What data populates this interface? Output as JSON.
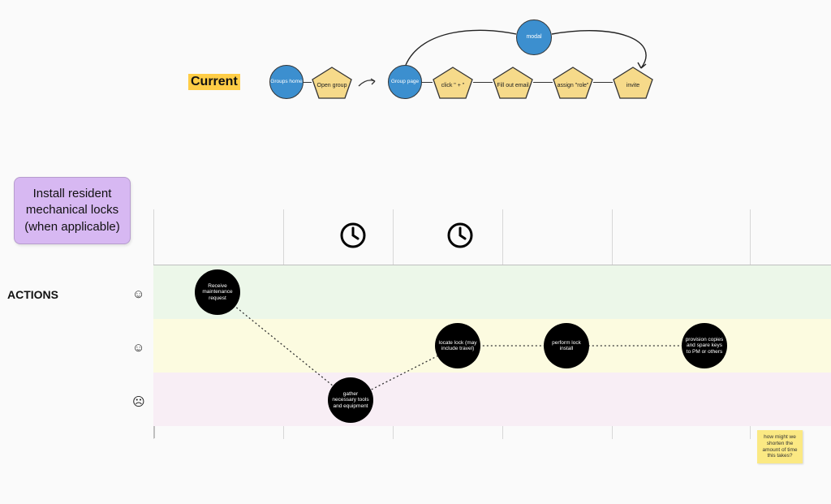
{
  "top_flow": {
    "label": "Current",
    "nodes": {
      "groups_home": "Groups home",
      "open_group": "Open group",
      "group_page": "Group page",
      "click_plus": "click \" + \"",
      "fill_email": "Fill out email",
      "assign_role": "assign \"role\"",
      "invite": "invite",
      "modal": "modal"
    }
  },
  "journey": {
    "card": "Install resident mechanical locks\n(when applicable)",
    "row_label": "ACTIONS",
    "faces": {
      "happy": "☺",
      "neutral": "☺",
      "sad": "☹"
    },
    "actions": [
      "Receive maintenance request",
      "gather necessary tools and equipment",
      "locate lock (may include travel)",
      "perform lock install",
      "provision copies and spare keys to PM or others"
    ],
    "sticky": "how might we shorten the amount of time this takes?"
  },
  "chart_data": {
    "type": "line",
    "title": "Install resident mechanical locks (when applicable) — ACTIONS sentiment",
    "categories": [
      "Receive maintenance request",
      "gather necessary tools and equipment",
      "locate lock (may include travel)",
      "perform lock install",
      "provision copies and spare keys to PM or others"
    ],
    "y_levels": [
      "happy",
      "neutral",
      "sad"
    ],
    "values": [
      "happy",
      "sad",
      "neutral",
      "neutral",
      "neutral"
    ]
  }
}
